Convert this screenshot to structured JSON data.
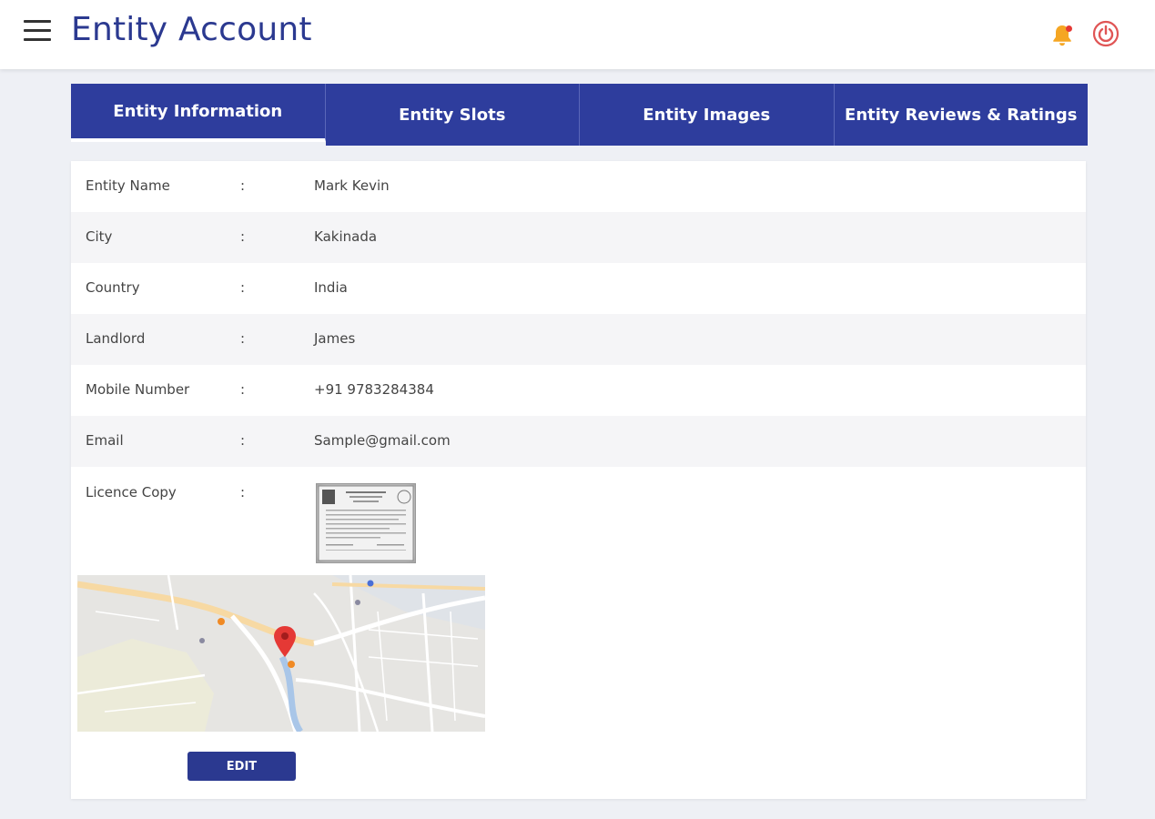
{
  "header": {
    "title": "Entity Account"
  },
  "tabs": [
    {
      "label": "Entity Information"
    },
    {
      "label": "Entity  Slots"
    },
    {
      "label": "Entity  Images"
    },
    {
      "label": "Entity  Reviews & Ratings"
    }
  ],
  "info": {
    "colon": ":",
    "rows": [
      {
        "label": "Entity Name",
        "value": "Mark Kevin"
      },
      {
        "label": "City",
        "value": "Kakinada"
      },
      {
        "label": "Country",
        "value": "India"
      },
      {
        "label": "Landlord",
        "value": "James"
      },
      {
        "label": "Mobile Number",
        "value": "+91 9783284384"
      },
      {
        "label": "Email",
        "value": "Sample@gmail.com"
      }
    ],
    "licence_label": "Licence Copy"
  },
  "edit_label": "EDIT",
  "colors": {
    "brand": "#2b3990",
    "tab_bg": "#2e3d9d",
    "bell": "#f5a623",
    "power": "#e05555",
    "map_pin": "#e53935"
  }
}
